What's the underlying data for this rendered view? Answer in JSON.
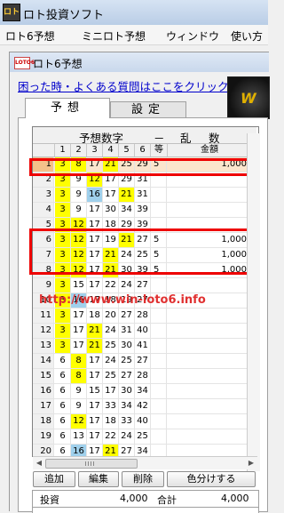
{
  "app": {
    "icon": "ロト",
    "title": "ロト投資ソフト"
  },
  "menu": [
    "ロト6予想",
    "ミニロト予想",
    "ウィンドウ",
    "使い方"
  ],
  "child_window": {
    "icon": "LOTO6",
    "title": "ロト6予想"
  },
  "faq_link": "困った時・よくある質問はここをクリック",
  "tabs": {
    "active": "予想",
    "inactive": "設定"
  },
  "grid": {
    "header": {
      "numbers": "予想数字",
      "dash": "－",
      "random": "乱",
      "count": "数"
    },
    "columns": [
      "1",
      "2",
      "3",
      "4",
      "5",
      "6",
      "等",
      "金額"
    ],
    "rows": [
      {
        "n": "1",
        "nums": [
          "3",
          "8",
          "17",
          "21",
          "25",
          "29"
        ],
        "grade": "5",
        "amount": "1,000",
        "hl": [
          "y",
          "y",
          "",
          "y",
          "",
          ""
        ],
        "sel": true
      },
      {
        "n": "2",
        "nums": [
          "3",
          "9",
          "12",
          "17",
          "29",
          "31"
        ],
        "grade": "",
        "amount": "",
        "hl": [
          "y",
          "",
          "y",
          "",
          "",
          ""
        ]
      },
      {
        "n": "3",
        "nums": [
          "3",
          "9",
          "16",
          "17",
          "21",
          "31"
        ],
        "grade": "",
        "amount": "",
        "hl": [
          "y",
          "",
          "b",
          "",
          "y",
          ""
        ]
      },
      {
        "n": "4",
        "nums": [
          "3",
          "9",
          "17",
          "30",
          "34",
          "39"
        ],
        "grade": "",
        "amount": "",
        "hl": [
          "y",
          "",
          "",
          "",
          "",
          ""
        ]
      },
      {
        "n": "5",
        "nums": [
          "3",
          "12",
          "17",
          "18",
          "29",
          "39"
        ],
        "grade": "",
        "amount": "",
        "hl": [
          "y",
          "y",
          "",
          "",
          "",
          ""
        ]
      },
      {
        "n": "6",
        "nums": [
          "3",
          "12",
          "17",
          "19",
          "21",
          "27"
        ],
        "grade": "5",
        "amount": "1,000",
        "hl": [
          "y",
          "y",
          "",
          "",
          "y",
          ""
        ]
      },
      {
        "n": "7",
        "nums": [
          "3",
          "12",
          "17",
          "21",
          "24",
          "25"
        ],
        "grade": "5",
        "amount": "1,000",
        "hl": [
          "y",
          "y",
          "",
          "y",
          "",
          ""
        ]
      },
      {
        "n": "8",
        "nums": [
          "3",
          "12",
          "17",
          "21",
          "30",
          "39"
        ],
        "grade": "5",
        "amount": "1,000",
        "hl": [
          "y",
          "y",
          "",
          "y",
          "",
          ""
        ]
      },
      {
        "n": "9",
        "nums": [
          "3",
          "15",
          "17",
          "22",
          "24",
          "27"
        ],
        "grade": "",
        "amount": "",
        "hl": [
          "y",
          "",
          "",
          "",
          "",
          ""
        ]
      },
      {
        "n": "10",
        "nums": [
          "3",
          "16",
          "17",
          "18",
          "19",
          "27"
        ],
        "grade": "",
        "amount": "",
        "hl": [
          "y",
          "b",
          "",
          "",
          "",
          ""
        ]
      },
      {
        "n": "11",
        "nums": [
          "3",
          "17",
          "18",
          "20",
          "27",
          "28"
        ],
        "grade": "",
        "amount": "",
        "hl": [
          "y",
          "",
          "",
          "",
          "",
          ""
        ]
      },
      {
        "n": "12",
        "nums": [
          "3",
          "17",
          "21",
          "24",
          "31",
          "40"
        ],
        "grade": "",
        "amount": "",
        "hl": [
          "y",
          "",
          "y",
          "",
          "",
          ""
        ]
      },
      {
        "n": "13",
        "nums": [
          "3",
          "17",
          "21",
          "25",
          "30",
          "41"
        ],
        "grade": "",
        "amount": "",
        "hl": [
          "y",
          "",
          "y",
          "",
          "",
          ""
        ]
      },
      {
        "n": "14",
        "nums": [
          "6",
          "8",
          "17",
          "24",
          "25",
          "27"
        ],
        "grade": "",
        "amount": "",
        "hl": [
          "",
          "y",
          "",
          "",
          "",
          ""
        ]
      },
      {
        "n": "15",
        "nums": [
          "6",
          "8",
          "17",
          "25",
          "27",
          "28"
        ],
        "grade": "",
        "amount": "",
        "hl": [
          "",
          "y",
          "",
          "",
          "",
          ""
        ]
      },
      {
        "n": "16",
        "nums": [
          "6",
          "9",
          "15",
          "17",
          "30",
          "34"
        ],
        "grade": "",
        "amount": "",
        "hl": [
          "",
          "",
          "",
          "",
          "",
          ""
        ]
      },
      {
        "n": "17",
        "nums": [
          "6",
          "9",
          "17",
          "33",
          "34",
          "42"
        ],
        "grade": "",
        "amount": "",
        "hl": [
          "",
          "",
          "",
          "",
          "",
          ""
        ]
      },
      {
        "n": "18",
        "nums": [
          "6",
          "12",
          "17",
          "18",
          "33",
          "40"
        ],
        "grade": "",
        "amount": "",
        "hl": [
          "",
          "y",
          "",
          "",
          "",
          ""
        ]
      },
      {
        "n": "19",
        "nums": [
          "6",
          "13",
          "17",
          "22",
          "24",
          "25"
        ],
        "grade": "",
        "amount": "",
        "hl": [
          "",
          "",
          "",
          "",
          "",
          ""
        ]
      },
      {
        "n": "20",
        "nums": [
          "6",
          "16",
          "17",
          "21",
          "27",
          "34"
        ],
        "grade": "",
        "amount": "",
        "hl": [
          "",
          "b",
          "",
          "y",
          "",
          ""
        ]
      }
    ]
  },
  "watermark": "http://www.win-loto6.info",
  "buttons": [
    "追加",
    "編集",
    "削除",
    "色分けする"
  ],
  "summary": {
    "invest_label": "投資",
    "invest_value": "4,000",
    "total_label": "合計",
    "total_value": "4,000"
  },
  "colors": {
    "highlight_yellow": "#ffff00",
    "highlight_blue": "#9fd0ec",
    "selected_row": "#fbe6cd",
    "annotation_red": "#e00000",
    "watermark": "#e03030"
  }
}
